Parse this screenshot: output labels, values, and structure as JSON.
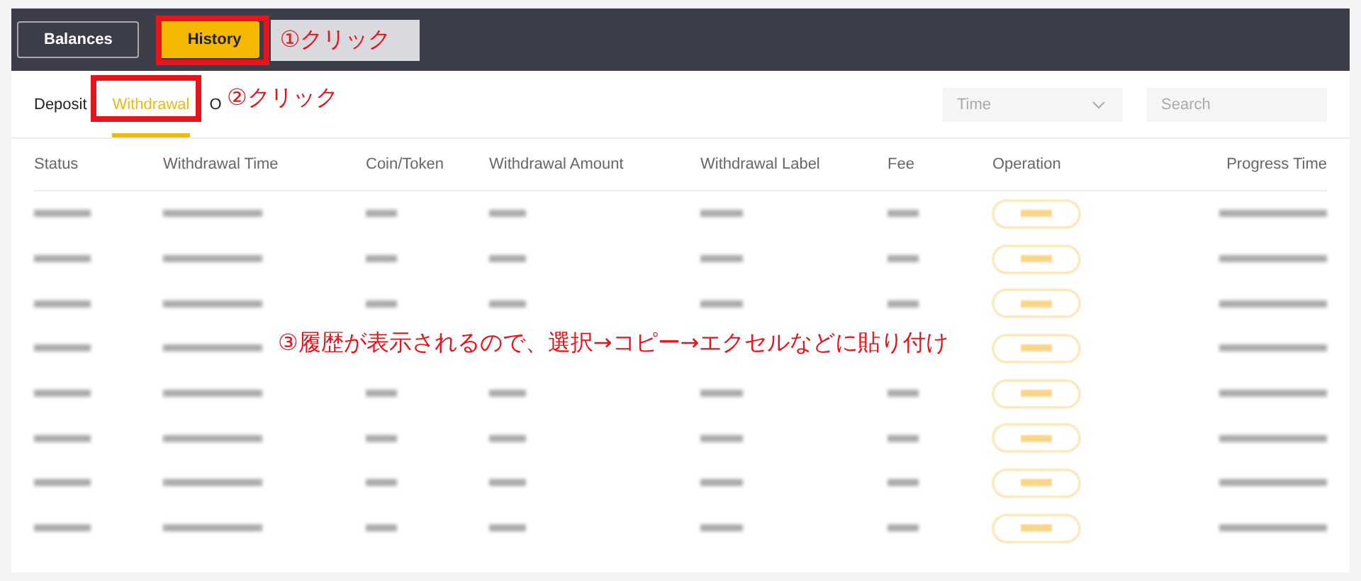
{
  "top_tabs": [
    {
      "label": "Balances",
      "selected": false
    },
    {
      "label": "History",
      "selected": true
    }
  ],
  "sub_tabs": [
    {
      "label": "Deposit",
      "selected": false
    },
    {
      "label": "Withdrawal",
      "selected": true
    },
    {
      "label": "O",
      "selected": false
    }
  ],
  "filters": {
    "time_select": {
      "value": "Time"
    },
    "search": {
      "placeholder": "Search"
    }
  },
  "table": {
    "columns": [
      "Status",
      "Withdrawal Time",
      "Coin/Token",
      "Withdrawal Amount",
      "Withdrawal Label",
      "Fee",
      "Operation",
      "Progress Time"
    ],
    "rows": [
      {
        "kind": "blurred"
      },
      {
        "kind": "blurred"
      },
      {
        "kind": "blurred"
      },
      {
        "kind": "blurred"
      },
      {
        "kind": "blurred"
      },
      {
        "kind": "blurred"
      },
      {
        "kind": "blurred"
      },
      {
        "kind": "blurred"
      }
    ]
  },
  "annotations": [
    "①クリック",
    "②クリック",
    "③履歴が表示されるので、選択→コピー→エクセルなどに貼り付け"
  ]
}
